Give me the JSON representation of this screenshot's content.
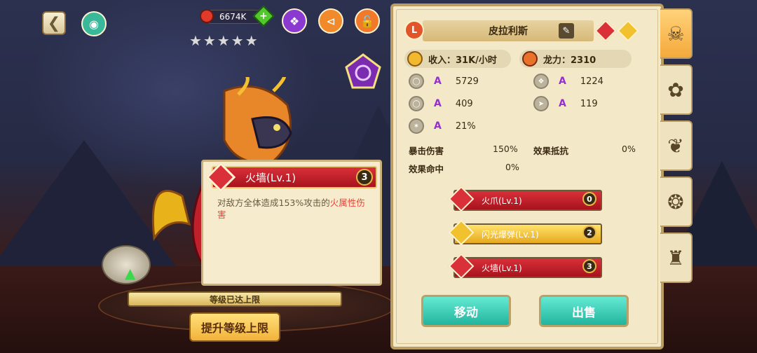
{
  "top": {
    "resource_value": "6674K",
    "stars": "★★★★★"
  },
  "level": {
    "status": "等级已达上限",
    "upgrade_button": "提升等级上限"
  },
  "tooltip": {
    "skill_name": "火墙(Lv.1)",
    "skill_badge": "3",
    "desc_text": "对敌方全体造成153%攻击的",
    "desc_highlight": "火属性伤害"
  },
  "monster": {
    "grade": "L",
    "name": "皮拉利斯",
    "income": "收入：31K/小时",
    "power": "龙力：2310"
  },
  "stats": {
    "s1": {
      "grade": "A",
      "value": "5729"
    },
    "s2": {
      "grade": "A",
      "value": "1224"
    },
    "s3": {
      "grade": "A",
      "value": "409"
    },
    "s4": {
      "grade": "A",
      "value": "119"
    },
    "s5": {
      "grade": "A",
      "value": "21%"
    },
    "crit_damage_label": "暴击伤害",
    "crit_damage_value": "150%",
    "resist_label": "效果抵抗",
    "resist_value": "0%",
    "accuracy_label": "效果命中",
    "accuracy_value": "0%"
  },
  "skills": [
    {
      "name": "火爪(Lv.1)",
      "count": "0"
    },
    {
      "name": "闪光爆弹(Lv.1)",
      "count": "2"
    },
    {
      "name": "火墙(Lv.1)",
      "count": "3"
    }
  ],
  "actions": {
    "move": "移动",
    "sell": "出售"
  },
  "colors": {
    "fire": "#d9303a",
    "light": "#f2c12e",
    "teal": "#22b49d",
    "grade_purple": "#9a2bd8"
  }
}
